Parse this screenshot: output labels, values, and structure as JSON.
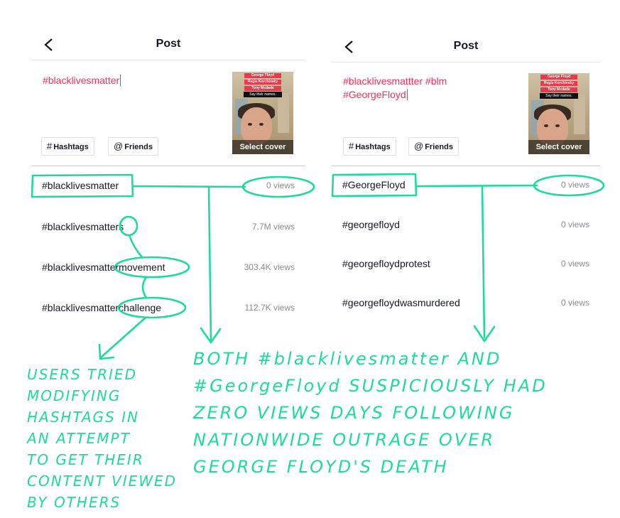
{
  "colors": {
    "accent": "#fe2c55",
    "annotation": "#1ddc9a",
    "muted": "#8a8b91"
  },
  "left_screen": {
    "title": "Post",
    "caption": "#blacklivesmatter",
    "thumbnail": {
      "names": [
        "George Floyd",
        "Regis Korchinsky",
        "Tony Mcdade"
      ],
      "overlay_text": "Say their names.",
      "cover_label": "Select cover"
    },
    "chips": {
      "hashtags": "Hashtags",
      "friends": "Friends"
    },
    "suggestions": [
      {
        "tag": "#blacklivesmatter",
        "views": "0 views"
      },
      {
        "tag": "#blacklivesmatters",
        "views": "7.7M views"
      },
      {
        "tag": "#blacklivesmattermovement",
        "views": "303.4K views"
      },
      {
        "tag": "#blacklivesmatterchallenge",
        "views": "112.7K views"
      }
    ]
  },
  "right_screen": {
    "title": "Post",
    "caption_line1": "#blacklivesmattter #blm",
    "caption_line2": "#GeorgeFloyd",
    "thumbnail": {
      "names": [
        "George Floyd",
        "Regis Korchinsky",
        "Tony Mcdade"
      ],
      "overlay_text": "Say their names.",
      "cover_label": "Select cover"
    },
    "chips": {
      "hashtags": "Hashtags",
      "friends": "Friends"
    },
    "suggestions": [
      {
        "tag": "#GeorgeFloyd",
        "views": "0 views"
      },
      {
        "tag": "#georgefloyd",
        "views": "0 views"
      },
      {
        "tag": "#georgefloydprotest",
        "views": "0 views"
      },
      {
        "tag": "#georgefloydwasmurdered",
        "views": "0 views"
      }
    ]
  },
  "annotations": {
    "left_note": [
      "USERS TRIED",
      "MODIFYING",
      "HASHTAGS IN",
      "AN ATTEMPT",
      "TO GET THEIR",
      "CONTENT VIEWED",
      "BY OTHERS"
    ],
    "right_note": [
      "BOTH #blacklivesmatter AND",
      "#GeorgeFloyd SUSPICIOUSLY HAD",
      "ZERO VIEWS DAYS FOLLOWING",
      "NATIONWIDE OUTRAGE OVER",
      "GEORGE FLOYD'S DEATH"
    ]
  }
}
